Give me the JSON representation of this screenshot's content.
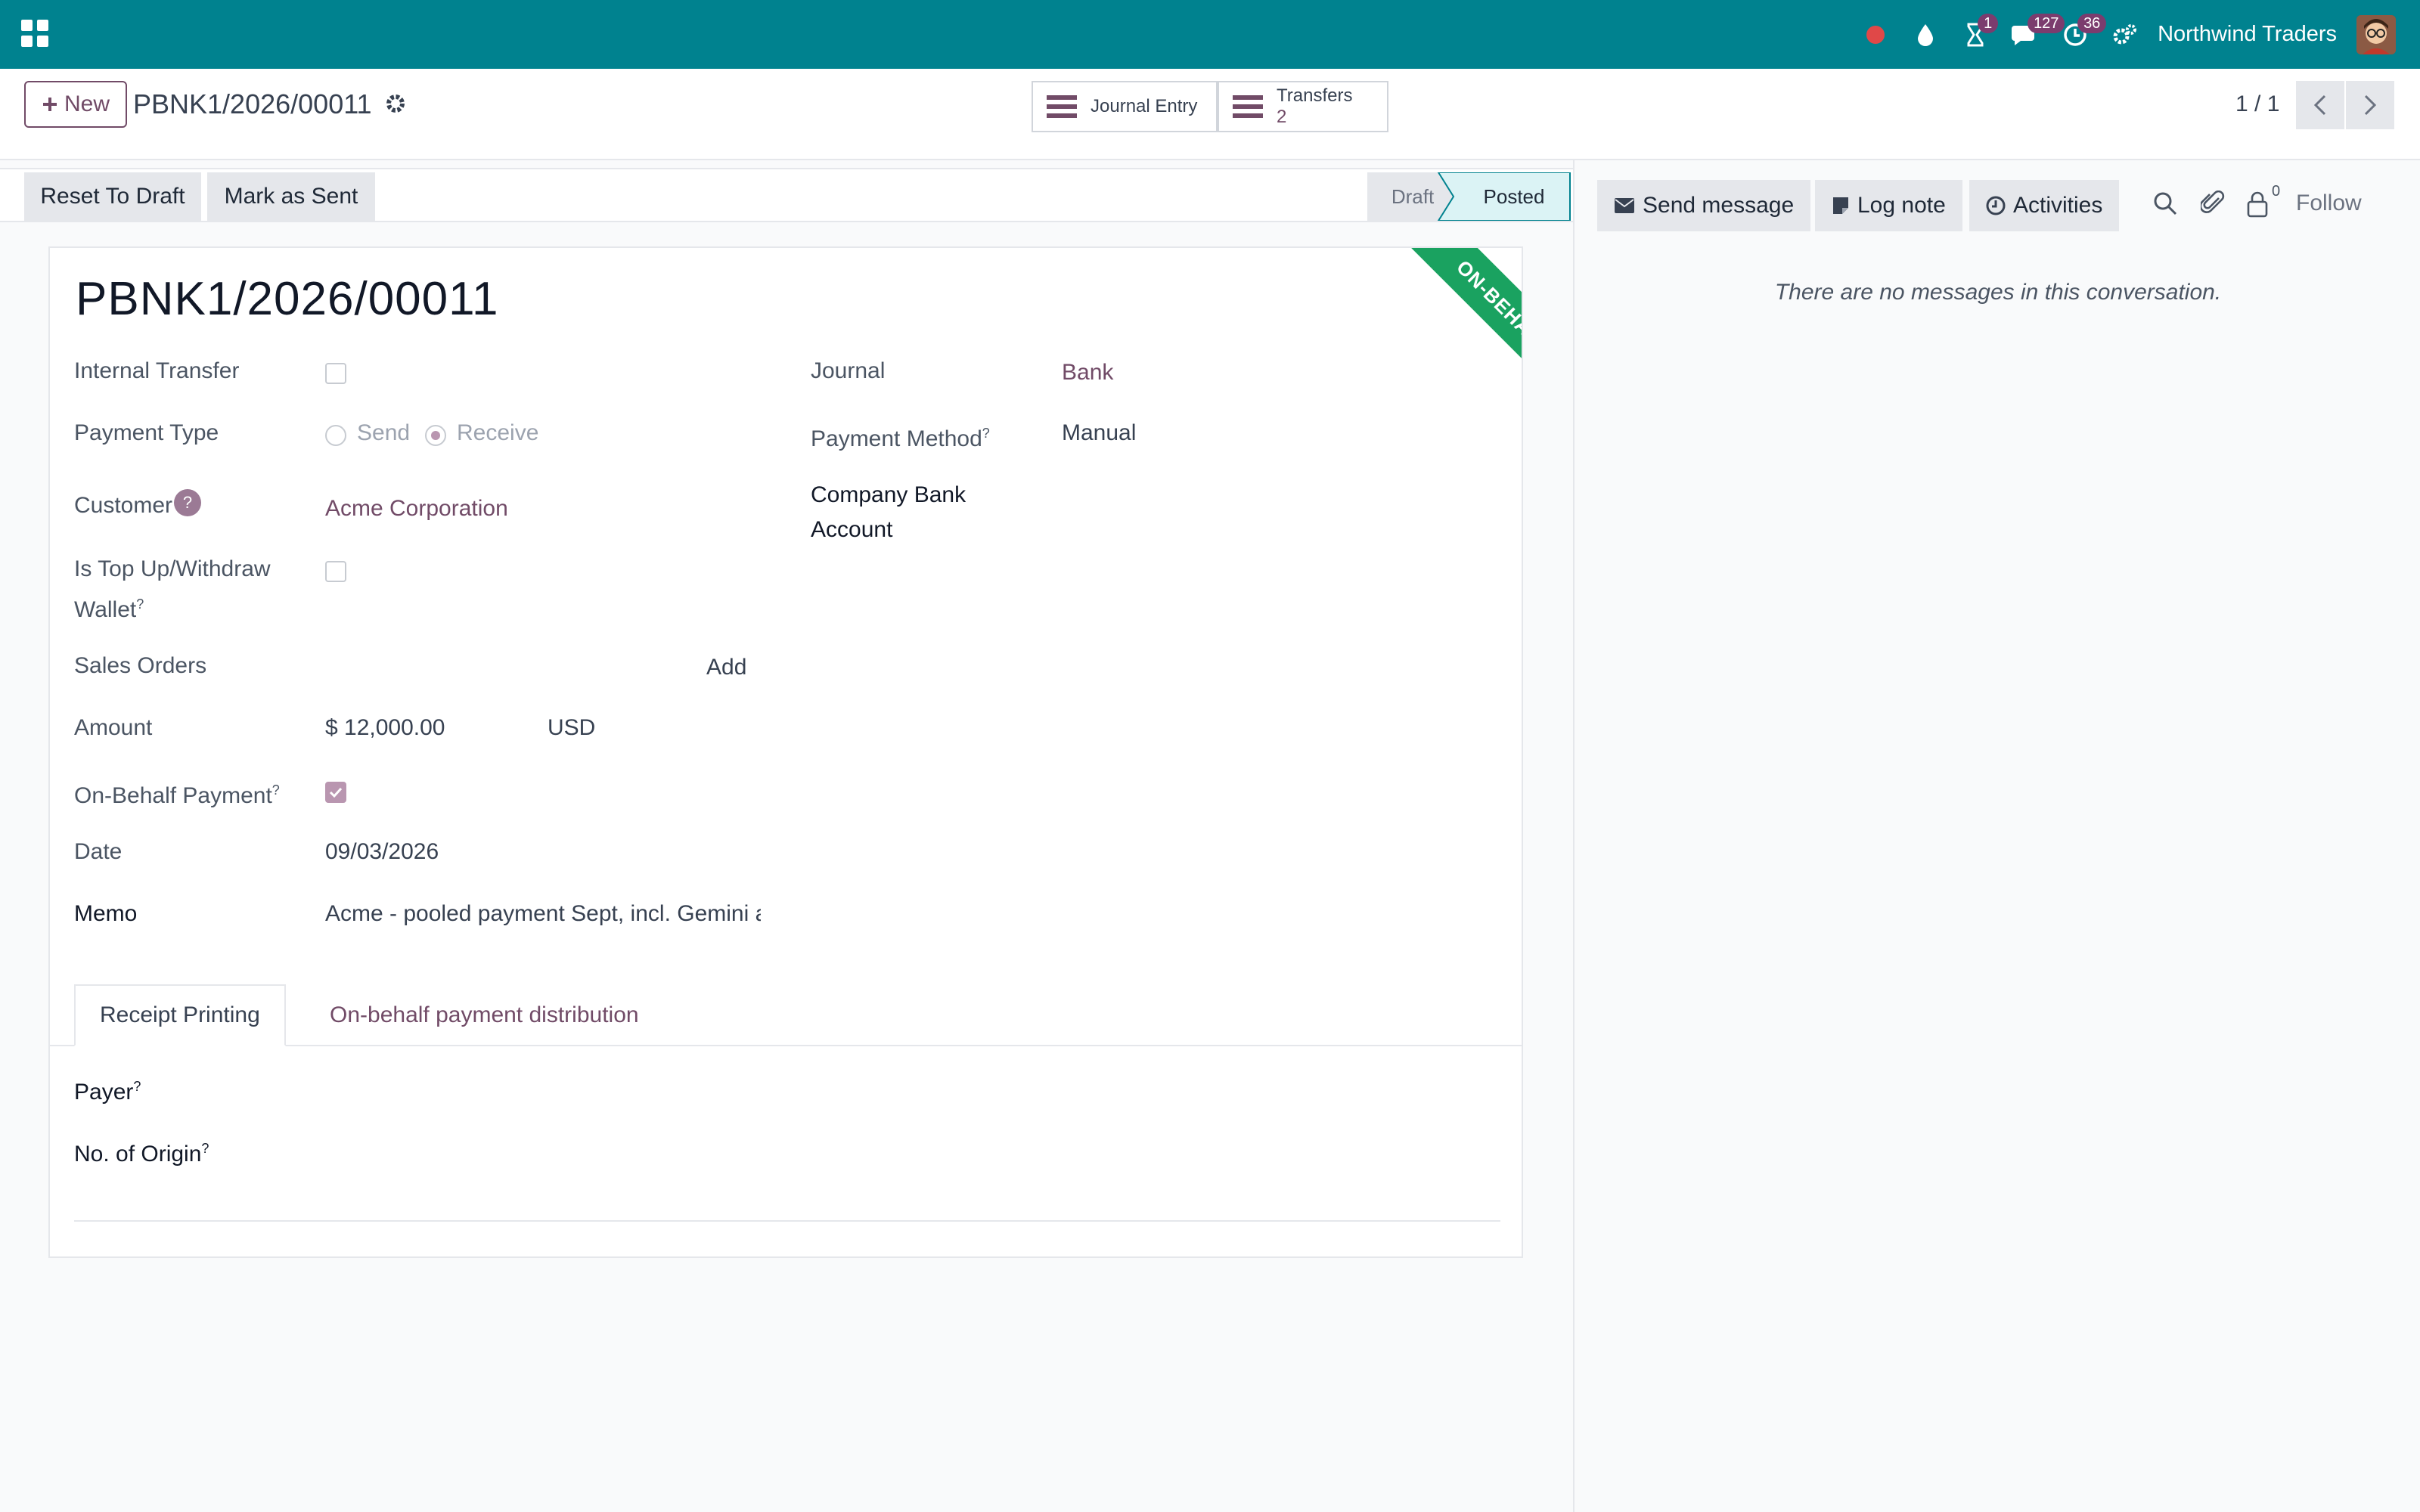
{
  "navbar": {
    "company": "Northwind Traders",
    "badges": {
      "activities": "1",
      "messages": "127",
      "clock": "36"
    },
    "colors": {
      "bg": "#00828f",
      "badge": "#7b3c6e"
    }
  },
  "control_panel": {
    "new_label": "New",
    "record_name": "PBNK1/2026/00011",
    "smart_buttons": [
      {
        "label": "Journal Entry",
        "count": ""
      },
      {
        "label": "Transfers",
        "count": "2"
      }
    ],
    "pager": "1 / 1"
  },
  "statusbar": {
    "buttons": [
      "Reset To Draft",
      "Mark as Sent"
    ],
    "stages": [
      {
        "label": "Draft",
        "active": false
      },
      {
        "label": "Posted",
        "active": true
      }
    ]
  },
  "form": {
    "title": "PBNK1/2026/00011",
    "ribbon": "ON-BEHALF NOT PAID",
    "left": {
      "internal_transfer_label": "Internal Transfer",
      "payment_type_label": "Payment Type",
      "payment_type_options": [
        "Send",
        "Receive"
      ],
      "payment_type_selected": "Receive",
      "customer_label": "Customer",
      "customer_help": "?",
      "customer_value": "Acme Corporation",
      "topup_label_1": "Is Top Up/Withdraw",
      "topup_label_2": "Wallet",
      "sales_orders_label": "Sales Orders",
      "sales_orders_add": "Add",
      "amount_label": "Amount",
      "amount_value": "$ 12,000.00",
      "currency": "USD",
      "onbehalf_label": "On-Behalf Payment",
      "date_label": "Date",
      "date_value": "09/03/2026",
      "memo_label": "Memo",
      "memo_value": "Acme - pooled payment Sept, incl. Gemini a"
    },
    "right": {
      "journal_label": "Journal",
      "journal_value": "Bank",
      "payment_method_label": "Payment Method",
      "payment_method_value": "Manual",
      "company_bank_label_1": "Company Bank",
      "company_bank_label_2": "Account"
    },
    "tabs": [
      "Receipt Printing",
      "On-behalf payment distribution"
    ],
    "tab_fields": {
      "payer_label": "Payer",
      "origin_label": "No. of Origin"
    },
    "help_marker": "?"
  },
  "chatter": {
    "send_message": "Send message",
    "log_note": "Log note",
    "activities": "Activities",
    "followers_count": "0",
    "follow": "Follow",
    "empty": "There are no messages in this conversation."
  }
}
